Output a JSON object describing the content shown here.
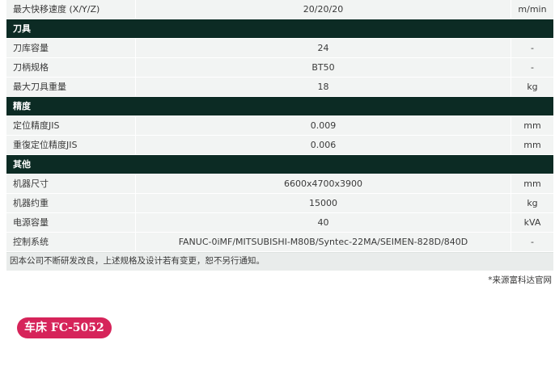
{
  "spec": {
    "top_row": {
      "label": "最大快移速度 (X/Y/Z)",
      "value": "20/20/20",
      "unit": "m/min"
    },
    "sections": [
      {
        "title": "刀具",
        "rows": [
          {
            "label": "刀库容量",
            "value": "24",
            "unit": "-"
          },
          {
            "label": "刀柄规格",
            "value": "BT50",
            "unit": "-"
          },
          {
            "label": "最大刀具重量",
            "value": "18",
            "unit": "kg"
          }
        ]
      },
      {
        "title": "精度",
        "rows": [
          {
            "label": "定位精度JIS",
            "value": "0.009",
            "unit": "mm"
          },
          {
            "label": "重復定位精度JIS",
            "value": "0.006",
            "unit": "mm"
          }
        ]
      },
      {
        "title": "其他",
        "rows": [
          {
            "label": "机器尺寸",
            "value": "6600x4700x3900",
            "unit": "mm"
          },
          {
            "label": "机器约重",
            "value": "15000",
            "unit": "kg"
          },
          {
            "label": "电源容量",
            "value": "40",
            "unit": "kVA"
          },
          {
            "label": "控制系统",
            "value": "FANUC-0iMF/MITSUBISHI-M80B/Syntec-22MA/SEIMEN-828D/840D",
            "unit": "-"
          }
        ]
      }
    ],
    "footnote": "因本公司不断研发改良，上述规格及设计若有变更，恕不另行通知。"
  },
  "source_note": "*来源富科达官网",
  "next_title": "车床 FC-5052",
  "colors": {
    "header_bg": "#0c2b24",
    "row_bg": "#f2f4f3",
    "pill_bg": "#d6245a"
  }
}
